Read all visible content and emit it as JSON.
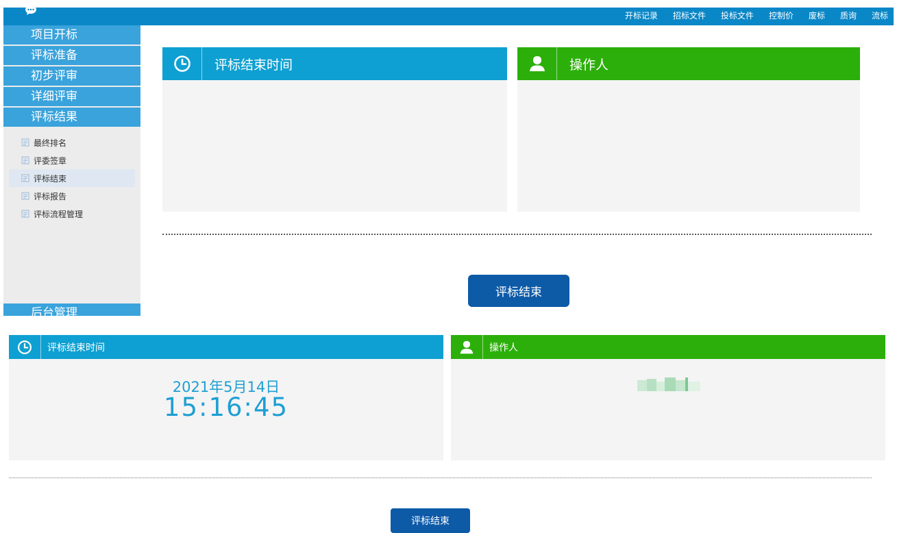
{
  "topnav": {
    "items": [
      "开标记录",
      "招标文件",
      "投标文件",
      "控制价",
      "废标",
      "质询",
      "流标"
    ]
  },
  "sidebar": {
    "menu": [
      "项目开标",
      "评标准备",
      "初步评审",
      "详细评审",
      "评标结果"
    ],
    "submenu": [
      "最终排名",
      "评委签章",
      "评标结束",
      "评标报告",
      "评标流程管理"
    ],
    "active_sub": "评标结束",
    "bottom": "后台管理"
  },
  "top_section": {
    "time_panel_title": "评标结束时间",
    "operator_panel_title": "操作人",
    "button_label": "评标结束"
  },
  "bottom_section": {
    "time_panel_title": "评标结束时间",
    "operator_panel_title": "操作人",
    "end_date": "2021年5月14日",
    "end_time": "15:16:45",
    "button_label": "评标结束"
  },
  "colors": {
    "topbar": "#0a87c7",
    "sidebar_menu": "#3aa3dc",
    "time_header": "#0ea0d2",
    "operator_header": "#2caf0a",
    "button": "#0d5aa7",
    "date_text": "#1d9fd3"
  },
  "icons": {
    "topbar": "chat-bubble-icon",
    "submenu": "document-icon",
    "time_header": "clock-icon",
    "operator_header": "user-icon"
  }
}
